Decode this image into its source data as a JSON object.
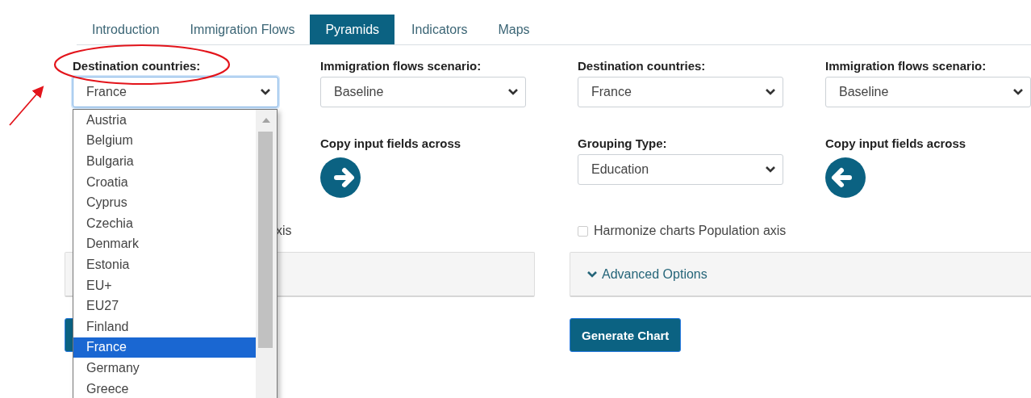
{
  "tabs": [
    {
      "label": "Introduction",
      "selected": false
    },
    {
      "label": "Immigration Flows",
      "selected": false
    },
    {
      "label": "Pyramids",
      "selected": true
    },
    {
      "label": "Indicators",
      "selected": false
    },
    {
      "label": "Maps",
      "selected": false
    }
  ],
  "panels": [
    {
      "destination": {
        "label": "Destination countries:",
        "value": "France",
        "open": true,
        "options": [
          {
            "label": "Austria",
            "selected": false
          },
          {
            "label": "Belgium",
            "selected": false
          },
          {
            "label": "Bulgaria",
            "selected": false
          },
          {
            "label": "Croatia",
            "selected": false
          },
          {
            "label": "Cyprus",
            "selected": false
          },
          {
            "label": "Czechia",
            "selected": false
          },
          {
            "label": "Denmark",
            "selected": false
          },
          {
            "label": "Estonia",
            "selected": false
          },
          {
            "label": "EU+",
            "selected": false
          },
          {
            "label": "EU27",
            "selected": false
          },
          {
            "label": "Finland",
            "selected": false
          },
          {
            "label": "France",
            "selected": true
          },
          {
            "label": "Germany",
            "selected": false
          },
          {
            "label": "Greece",
            "selected": false
          }
        ]
      },
      "scenario": {
        "label": "Immigration flows scenario:",
        "value": "Baseline"
      },
      "copy": {
        "label": "Copy input fields across",
        "kind": "forward"
      },
      "harmonize": {
        "label": "xis"
      },
      "generate": {
        "kind": "covered"
      }
    },
    {
      "destination": {
        "label": "Destination countries:",
        "value": "France",
        "open": false
      },
      "scenario": {
        "label": "Immigration flows scenario:",
        "value": "Baseline"
      },
      "grouping": {
        "label": "Grouping Type:",
        "value": "Education"
      },
      "copy": {
        "label": "Copy input fields across",
        "kind": "back"
      },
      "harmonize": {
        "label": "Harmonize charts Population axis",
        "checked": false
      },
      "advanced": {
        "label": "Advanced Options"
      },
      "generate": {
        "kind": "full",
        "label": "Generate Chart"
      }
    }
  ]
}
